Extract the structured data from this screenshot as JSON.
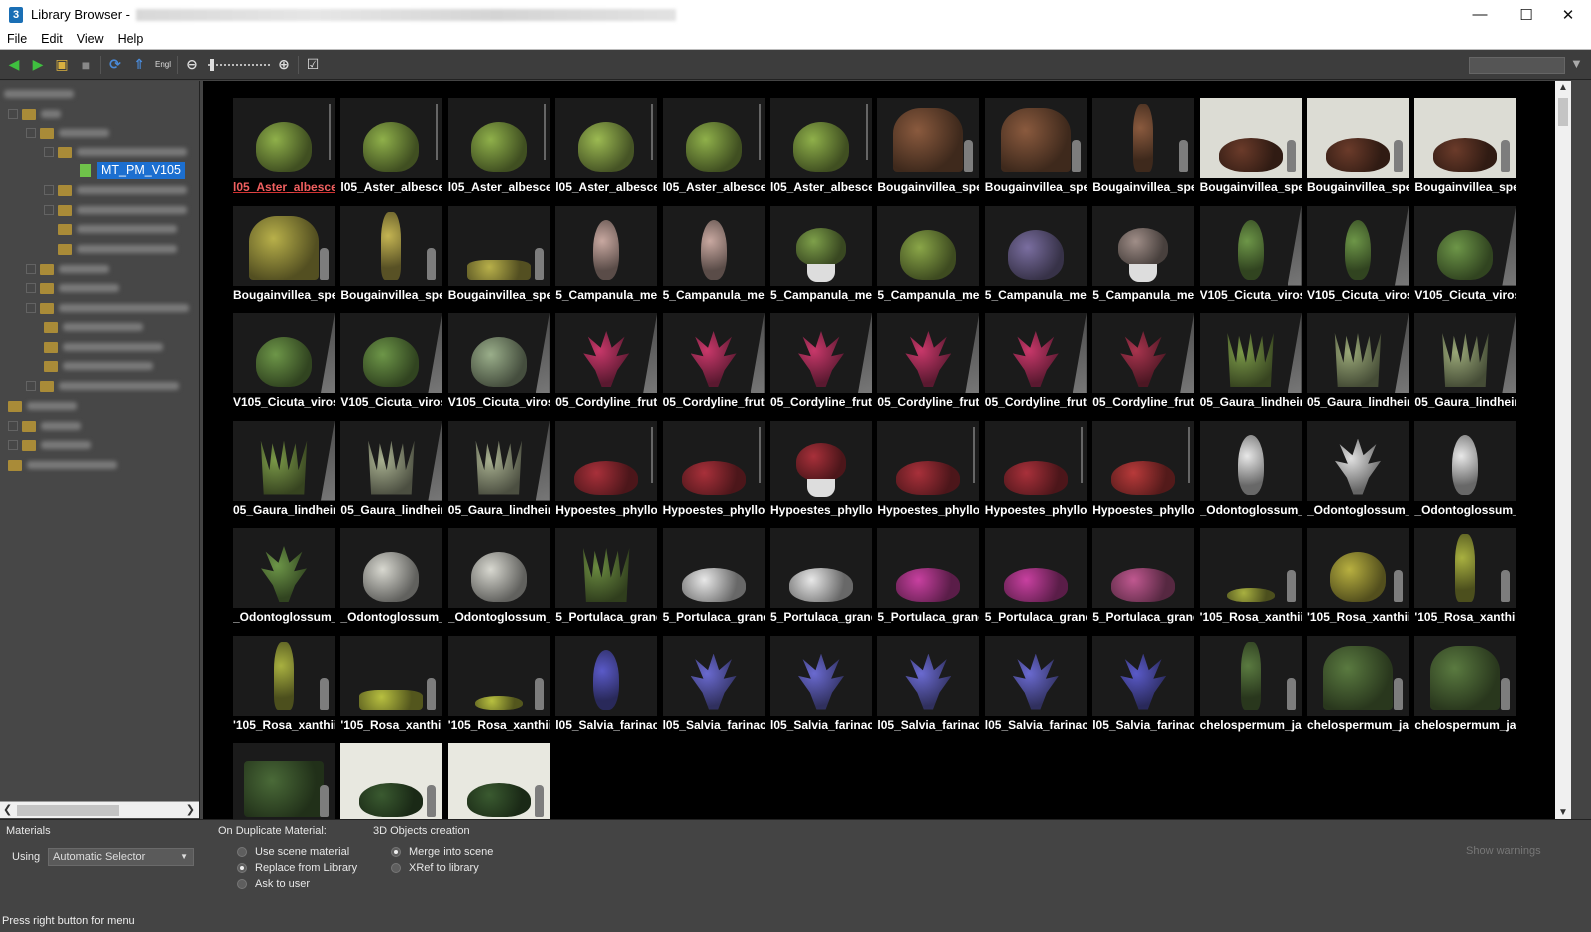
{
  "window": {
    "title": "Library Browser -",
    "app_icon": "3ds-max-icon",
    "controls": {
      "minimize": "—",
      "maximize": "☐",
      "close": "✕"
    }
  },
  "menubar": {
    "items": [
      "File",
      "Edit",
      "View",
      "Help"
    ]
  },
  "toolbar": {
    "icons": [
      "back-arrow-icon",
      "forward-arrow-icon",
      "open-folder-icon",
      "save-icon",
      "refresh-icon",
      "sort-up-icon",
      "language-icon",
      "zoom-out-icon",
      "zoom-slider",
      "zoom-in-icon",
      "checklist-icon"
    ],
    "filter_icon": "funnel-icon"
  },
  "tree": {
    "selected_label": "MT_PM_V105"
  },
  "thumbnails": {
    "items": [
      {
        "label": "l05_Aster_albesce",
        "kind": "shrub",
        "color": "#8fb04a",
        "extra": "ruler",
        "selected": true
      },
      {
        "label": "l05_Aster_albesce",
        "kind": "shrub",
        "color": "#8fb04a",
        "extra": "ruler"
      },
      {
        "label": "l05_Aster_albesce",
        "kind": "shrub",
        "color": "#8fb04a",
        "extra": "ruler"
      },
      {
        "label": "l05_Aster_albesce",
        "kind": "shrub",
        "color": "#9cba52",
        "extra": "ruler"
      },
      {
        "label": "l05_Aster_albesce",
        "kind": "shrub",
        "color": "#8fb04a",
        "extra": "ruler"
      },
      {
        "label": "l05_Aster_albesce",
        "kind": "shrub",
        "color": "#8fb04a",
        "extra": "ruler"
      },
      {
        "label": "Bougainvillea_spe",
        "kind": "arch",
        "color": "#8a5a3e",
        "extra": "person"
      },
      {
        "label": "Bougainvillea_spe",
        "kind": "arch",
        "color": "#8a5a3e",
        "extra": "person"
      },
      {
        "label": "Bougainvillea_spe",
        "kind": "column",
        "color": "#8a5a3e",
        "extra": "person"
      },
      {
        "label": "Bougainvillea_spe",
        "kind": "mound",
        "color": "#6b3b2a",
        "extra": "person",
        "bg": "light"
      },
      {
        "label": "Bougainvillea_spe",
        "kind": "mound",
        "color": "#6b3b2a",
        "extra": "person",
        "bg": "light"
      },
      {
        "label": "Bougainvillea_spe",
        "kind": "mound",
        "color": "#6b3b2a",
        "extra": "person",
        "bg": "light"
      },
      {
        "label": "Bougainvillea_spe",
        "kind": "arch",
        "color": "#b8b04a",
        "extra": "person"
      },
      {
        "label": "Bougainvillea_spe",
        "kind": "column",
        "color": "#c4b452",
        "extra": "person"
      },
      {
        "label": "Bougainvillea_spe",
        "kind": "planter",
        "color": "#b8b04a",
        "extra": "person"
      },
      {
        "label": "5_Campanula_me",
        "kind": "stem",
        "color": "#c8a8a0",
        "extra": ""
      },
      {
        "label": "5_Campanula_me",
        "kind": "stem",
        "color": "#c8a8a0",
        "extra": ""
      },
      {
        "label": "5_Campanula_me",
        "kind": "potted",
        "color": "#7ea04a",
        "extra": "pot"
      },
      {
        "label": "5_Campanula_me",
        "kind": "shrub",
        "color": "#8aa648",
        "extra": ""
      },
      {
        "label": "5_Campanula_me",
        "kind": "shrub",
        "color": "#7a6ea0",
        "extra": ""
      },
      {
        "label": "5_Campanula_me",
        "kind": "potted",
        "color": "#a08e88",
        "extra": "pot"
      },
      {
        "label": "V105_Cicuta_viros",
        "kind": "stem",
        "color": "#6d9648",
        "extra": "wall"
      },
      {
        "label": "V105_Cicuta_viros",
        "kind": "stem",
        "color": "#6d9648",
        "extra": "wall"
      },
      {
        "label": "V105_Cicuta_viros",
        "kind": "shrub",
        "color": "#6d9648",
        "extra": "wall"
      },
      {
        "label": "V105_Cicuta_viros",
        "kind": "shrub",
        "color": "#6d9648",
        "extra": "wall"
      },
      {
        "label": "V105_Cicuta_viros",
        "kind": "shrub",
        "color": "#6d9648",
        "extra": "wall"
      },
      {
        "label": "V105_Cicuta_viros",
        "kind": "shrub",
        "color": "#9aae8a",
        "extra": "wall"
      },
      {
        "label": "05_Cordyline_fruti",
        "kind": "spiky",
        "color": "#c8386a",
        "extra": "wall"
      },
      {
        "label": "05_Cordyline_fruti",
        "kind": "spiky",
        "color": "#c8386a",
        "extra": "wall"
      },
      {
        "label": "05_Cordyline_fruti",
        "kind": "spiky",
        "color": "#c8386a",
        "extra": "wall"
      },
      {
        "label": "05_Cordyline_fruti",
        "kind": "spiky",
        "color": "#c8386a",
        "extra": "wall"
      },
      {
        "label": "05_Cordyline_fruti",
        "kind": "spiky",
        "color": "#c8386a",
        "extra": "wall"
      },
      {
        "label": "05_Cordyline_fruti",
        "kind": "spiky",
        "color": "#a8344e",
        "extra": "wall"
      },
      {
        "label": "05_Gaura_lindhein",
        "kind": "grass",
        "color": "#7a9848",
        "extra": "wall"
      },
      {
        "label": "05_Gaura_lindhein",
        "kind": "grass",
        "color": "#9aa878",
        "extra": "wall"
      },
      {
        "label": "05_Gaura_lindhein",
        "kind": "grass",
        "color": "#9aa878",
        "extra": "wall"
      },
      {
        "label": "05_Gaura_lindhein",
        "kind": "grass",
        "color": "#7a9848",
        "extra": "wall"
      },
      {
        "label": "05_Gaura_lindhein",
        "kind": "grass",
        "color": "#a8b090",
        "extra": "wall"
      },
      {
        "label": "05_Gaura_lindhein",
        "kind": "grass",
        "color": "#a8b090",
        "extra": "wall"
      },
      {
        "label": "Hypoestes_phyllos",
        "kind": "mound",
        "color": "#a8303a",
        "extra": "ruler"
      },
      {
        "label": "Hypoestes_phyllos",
        "kind": "mound",
        "color": "#a8303a",
        "extra": "ruler"
      },
      {
        "label": "Hypoestes_phyllos",
        "kind": "potted",
        "color": "#a8303a",
        "extra": "pot"
      },
      {
        "label": "Hypoestes_phyllos",
        "kind": "mound",
        "color": "#a8303a",
        "extra": "ruler"
      },
      {
        "label": "Hypoestes_phyllos",
        "kind": "mound",
        "color": "#a8303a",
        "extra": "ruler"
      },
      {
        "label": "Hypoestes_phyllos",
        "kind": "mound",
        "color": "#b83a3a",
        "extra": "ruler"
      },
      {
        "label": "_Odontoglossum_c",
        "kind": "stem",
        "color": "#e8e8e8",
        "extra": ""
      },
      {
        "label": "_Odontoglossum_c",
        "kind": "spiky",
        "color": "#e0e0e0",
        "extra": ""
      },
      {
        "label": "_Odontoglossum_c",
        "kind": "stem",
        "color": "#e8e8e8",
        "extra": ""
      },
      {
        "label": "_Odontoglossum_c",
        "kind": "spiky",
        "color": "#6d9648",
        "extra": ""
      },
      {
        "label": "_Odontoglossum_c",
        "kind": "shrub",
        "color": "#d8d8d0",
        "extra": ""
      },
      {
        "label": "_Odontoglossum_c",
        "kind": "shrub",
        "color": "#d8d8d0",
        "extra": ""
      },
      {
        "label": "5_Portulaca_grand",
        "kind": "grass",
        "color": "#6a8a40",
        "extra": ""
      },
      {
        "label": "5_Portulaca_grand",
        "kind": "mound",
        "color": "#e8e8e8",
        "extra": ""
      },
      {
        "label": "5_Portulaca_grand",
        "kind": "mound",
        "color": "#e8e8e8",
        "extra": ""
      },
      {
        "label": "5_Portulaca_grand",
        "kind": "mound",
        "color": "#c840a0",
        "extra": ""
      },
      {
        "label": "5_Portulaca_grand",
        "kind": "mound",
        "color": "#c840a0",
        "extra": ""
      },
      {
        "label": "5_Portulaca_grand",
        "kind": "mound",
        "color": "#c05890",
        "extra": ""
      },
      {
        "label": "'105_Rosa_xanthii",
        "kind": "low",
        "color": "#a8b040",
        "extra": "person"
      },
      {
        "label": "'105_Rosa_xanthii",
        "kind": "shrub",
        "color": "#b8b040",
        "extra": "person"
      },
      {
        "label": "'105_Rosa_xanthii",
        "kind": "column",
        "color": "#a8b040",
        "extra": "person"
      },
      {
        "label": "'105_Rosa_xanthii",
        "kind": "column",
        "color": "#a8b040",
        "extra": "person"
      },
      {
        "label": "'105_Rosa_xanthii",
        "kind": "planter",
        "color": "#b8c040",
        "extra": "person"
      },
      {
        "label": "'105_Rosa_xanthii",
        "kind": "low",
        "color": "#b8c040",
        "extra": "person"
      },
      {
        "label": "l05_Salvia_farinac",
        "kind": "stem",
        "color": "#5a5ac8",
        "extra": ""
      },
      {
        "label": "l05_Salvia_farinac",
        "kind": "spiky",
        "color": "#6a6ad0",
        "extra": ""
      },
      {
        "label": "l05_Salvia_farinac",
        "kind": "spiky",
        "color": "#6a6ad0",
        "extra": ""
      },
      {
        "label": "l05_Salvia_farinac",
        "kind": "spiky",
        "color": "#6a6ad0",
        "extra": ""
      },
      {
        "label": "l05_Salvia_farinac",
        "kind": "spiky",
        "color": "#6a6ad0",
        "extra": ""
      },
      {
        "label": "l05_Salvia_farinac",
        "kind": "spiky",
        "color": "#5a5ac8",
        "extra": ""
      },
      {
        "label": "chelospermum_ja",
        "kind": "column",
        "color": "#5a7a40",
        "extra": "person"
      },
      {
        "label": "chelospermum_ja",
        "kind": "arch",
        "color": "#5a7a40",
        "extra": "person"
      },
      {
        "label": "chelospermum_ja",
        "kind": "arch",
        "color": "#5a7a40",
        "extra": "person"
      },
      {
        "label": "",
        "kind": "fence",
        "color": "#4a6a38",
        "extra": "person"
      },
      {
        "label": "",
        "kind": "mound",
        "color": "#3a5a30",
        "extra": "person",
        "bg": "light2"
      },
      {
        "label": "",
        "kind": "mound",
        "color": "#3a5a30",
        "extra": "person",
        "bg": "light2"
      }
    ]
  },
  "bottom": {
    "materials_title": "Materials",
    "using_label": "Using",
    "using_value": "Automatic Selector",
    "duplicate_title": "On Duplicate Material:",
    "duplicate_options": [
      {
        "label": "Use scene material",
        "checked": false
      },
      {
        "label": "Replace from Library",
        "checked": true
      },
      {
        "label": "Ask to user",
        "checked": false
      }
    ],
    "objects_title": "3D Objects creation",
    "objects_options": [
      {
        "label": "Merge into scene",
        "checked": true
      },
      {
        "label": "XRef to library",
        "checked": false
      }
    ],
    "show_warnings": "Show warnings",
    "status": "Press right button for menu"
  }
}
